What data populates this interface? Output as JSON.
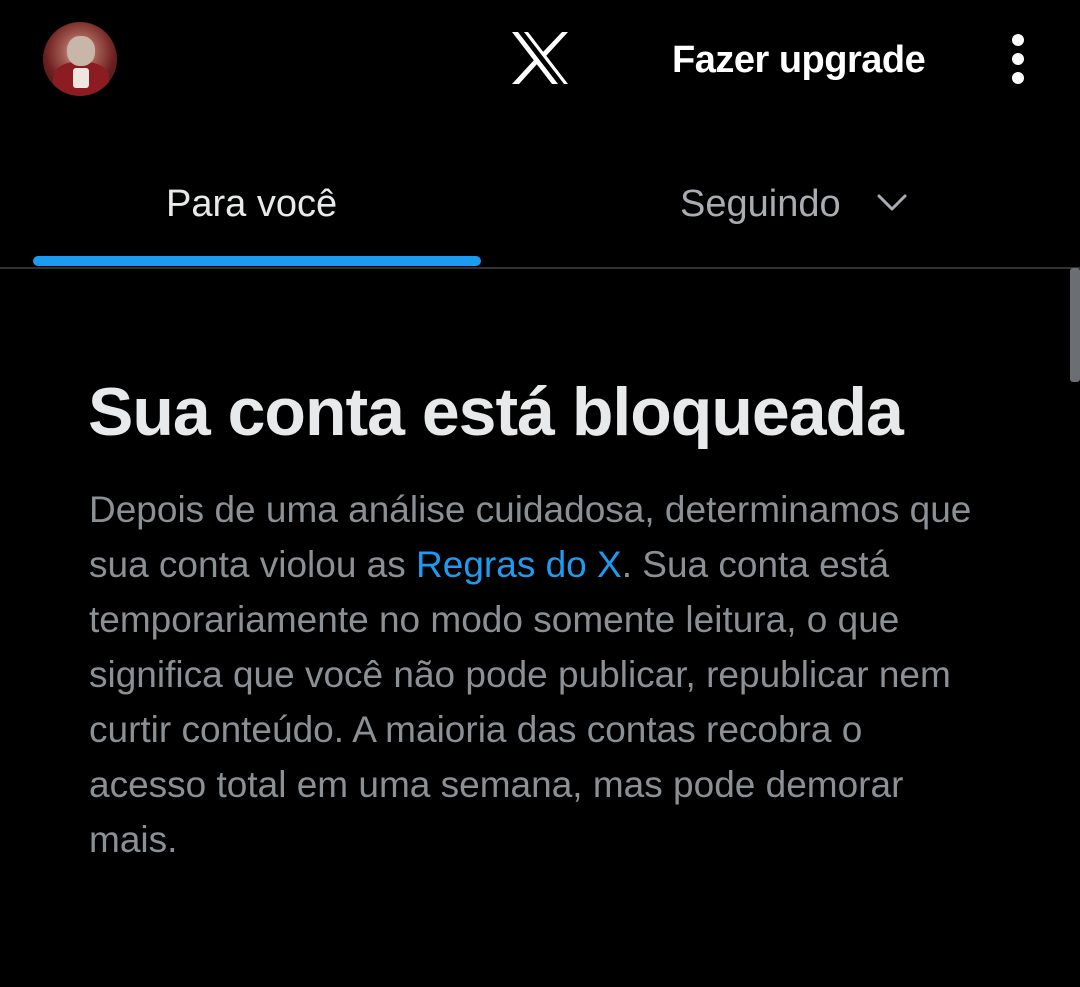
{
  "header": {
    "upgrade_label": "Fazer upgrade"
  },
  "tabs": [
    {
      "label": "Para você",
      "active": true
    },
    {
      "label": "Seguindo",
      "active": false
    }
  ],
  "notice": {
    "title": "Sua conta está bloqueada",
    "body_before_link": "Depois de uma análise cuidadosa, determinamos que sua conta violou as ",
    "link_text": "Regras do X",
    "body_after_link": ". Sua conta está temporariamente no modo somente leitura, o que significa que você não pode publicar, republicar nem curtir conteúdo. A maioria das contas recobra o acesso total em uma semana, mas pode demorar mais."
  },
  "colors": {
    "background": "#000000",
    "accent": "#1d9bf0",
    "primary_text": "#e7e9ea",
    "secondary_text": "#8b9095",
    "divider": "#2f3336"
  },
  "icons": {
    "logo": "x-logo-icon",
    "more": "more-vertical-icon",
    "following_dropdown": "chevron-down-icon"
  }
}
